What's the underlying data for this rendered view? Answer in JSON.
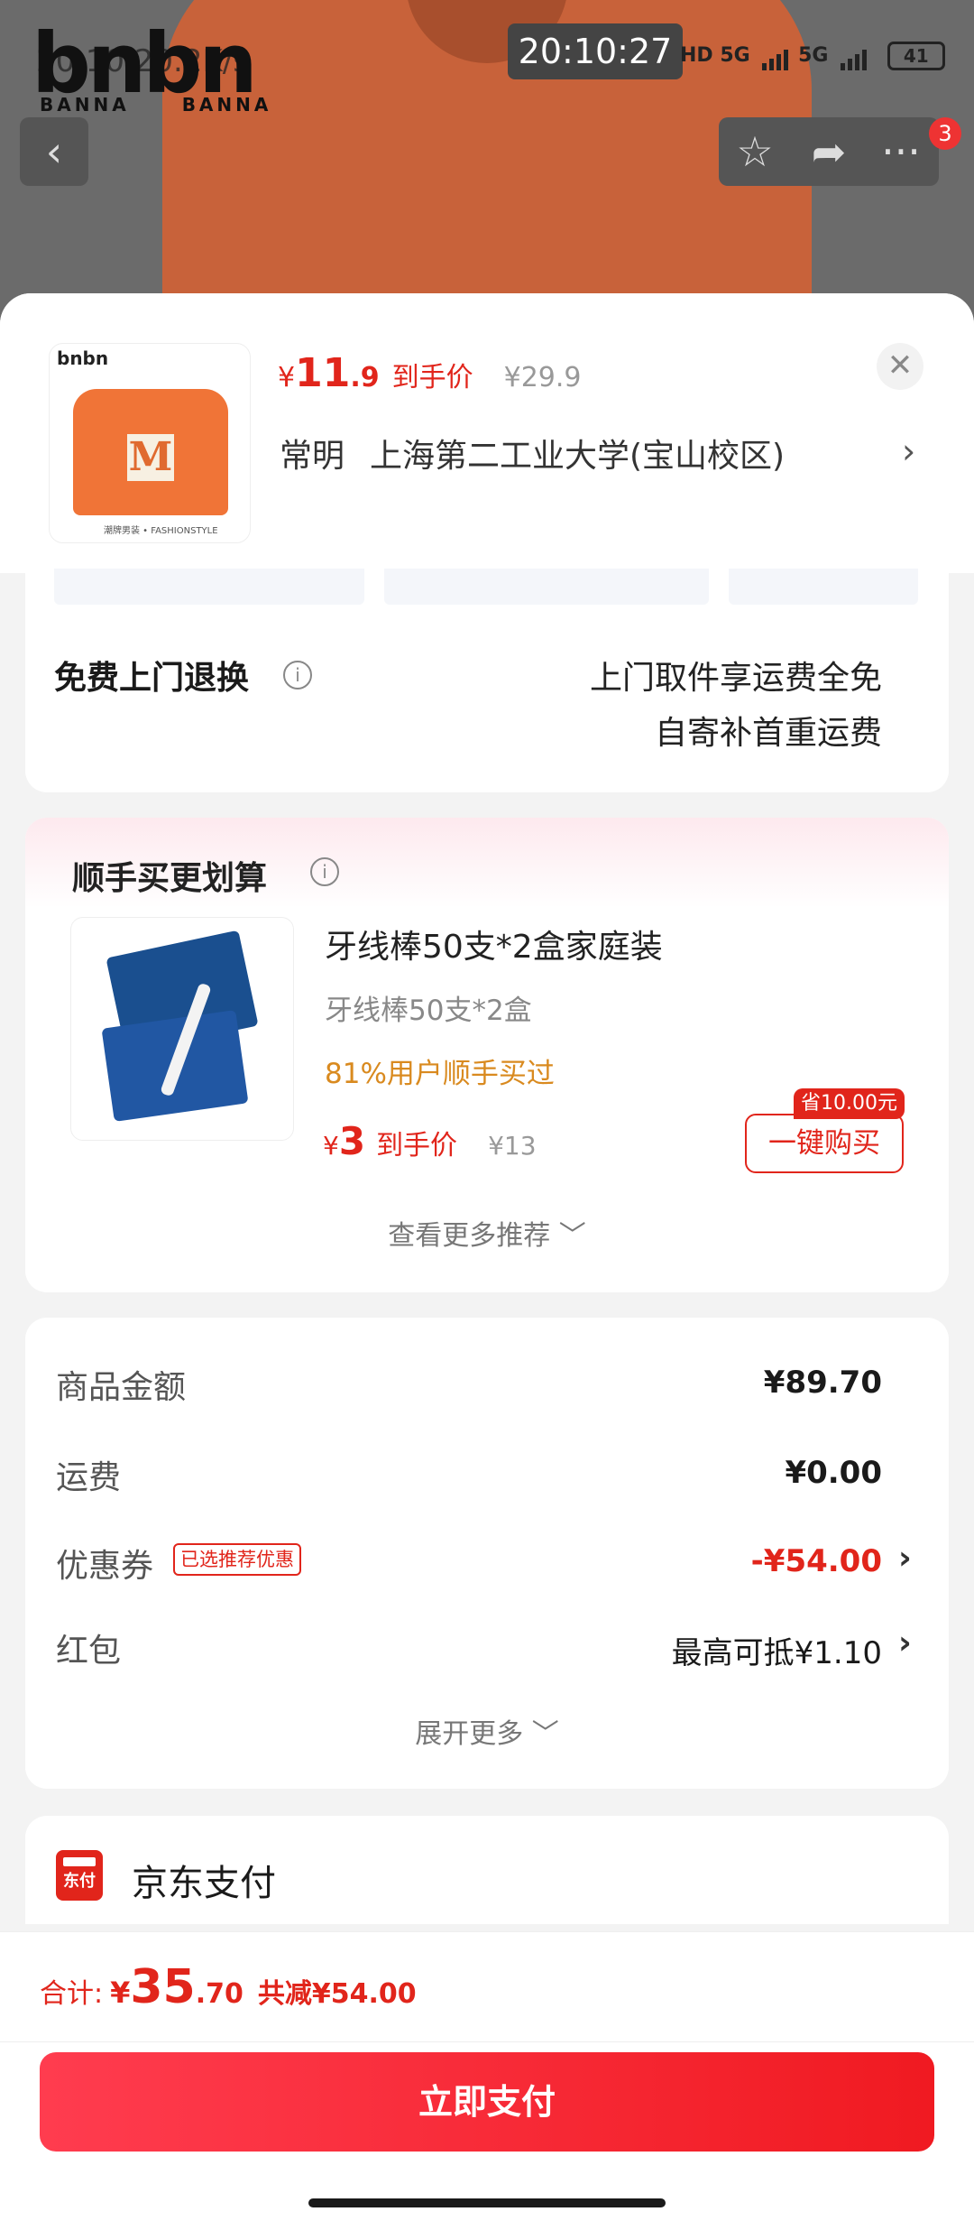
{
  "status_bar": {
    "left_text": "20:10 20.2K/s",
    "time": "20:10:27",
    "net1": "HD",
    "net2": "5G",
    "net3": "5G",
    "battery": "41"
  },
  "brand": {
    "logo": "bnbn",
    "sub_left": "BANNA",
    "sub_right": "BANNA"
  },
  "header": {
    "back_icon": "back-chevron-icon",
    "actions": [
      "star-icon",
      "share-icon",
      "more-icon"
    ],
    "badge": "3"
  },
  "product": {
    "currency": "¥",
    "price_int": "11",
    "price_dec": ".9",
    "price_tag": "到手价",
    "orig_price": "¥29.9",
    "address_city": "常明",
    "address": "上海第二工业大学(宝山校区)",
    "thumb_logo": "bnbn",
    "thumb_letter": "M",
    "thumb_caption": "潮牌男装 • FASHIONSTYLE"
  },
  "service": {
    "title": "免费上门退换",
    "line1": "上门取件享运费全免",
    "line2": "自寄补首重运费"
  },
  "recommend": {
    "title": "顺手买更划算",
    "item_name": "牙线棒50支*2盒家庭装",
    "item_spec": "牙线棒50支*2盒",
    "users": "81%用户顺手买过",
    "currency": "¥",
    "price": "3",
    "price_tag": "到手价",
    "orig_price": "¥13",
    "save_badge": "省10.00元",
    "buy_label": "一键购买",
    "more": "查看更多推荐 ﹀"
  },
  "details": {
    "rows": [
      {
        "label": "商品金额",
        "value": "¥89.70"
      },
      {
        "label": "运费",
        "value": "¥0.00"
      },
      {
        "label": "优惠券",
        "value": "-¥54.00",
        "tag": "已选推荐优惠"
      },
      {
        "label": "红包",
        "value": "最高可抵¥1.10"
      }
    ],
    "expand": "展开更多 ﹀"
  },
  "payment": {
    "icon_text": "东付",
    "name": "京东支付"
  },
  "footer": {
    "total_label": "合计:",
    "currency": "¥",
    "total_int": "35",
    "total_dec": ".70",
    "saved": "共减¥54.00",
    "pay_button": "立即支付"
  },
  "colors": {
    "accent": "#e1251b",
    "orange_text": "#d98a1f"
  }
}
